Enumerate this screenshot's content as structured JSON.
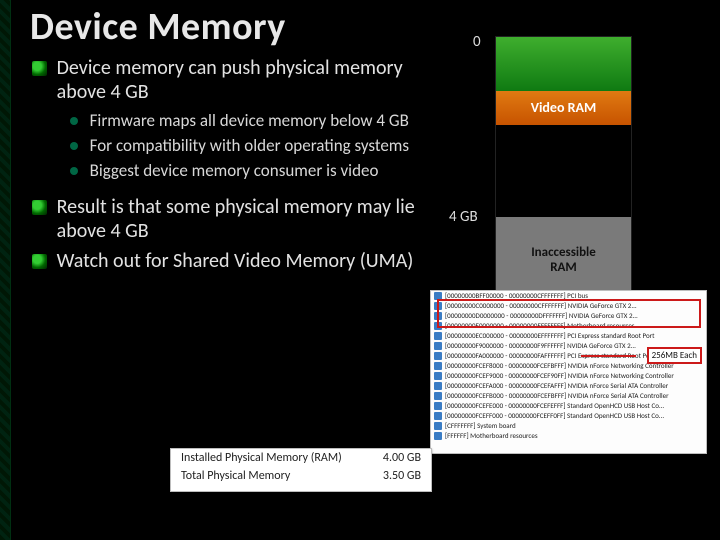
{
  "title": "Device Memory",
  "bullets": [
    {
      "text": "Device memory can push physical memory above 4 GB",
      "sub": [
        "Firmware maps all device memory below 4 GB",
        "For compatibility with older operating systems",
        "Biggest device memory consumer is video"
      ]
    },
    {
      "text": "Result is that some physical memory may lie above 4 GB"
    },
    {
      "text": "Watch out for Shared Video Memory (UMA)"
    }
  ],
  "memmap": {
    "ticks": [
      "0",
      "4 GB"
    ],
    "segments": [
      {
        "label": "",
        "color": "#1f9f1f"
      },
      {
        "label": "Video RAM",
        "color": "#d96a00"
      },
      {
        "label": "",
        "color": "#000000"
      },
      {
        "label": "Inaccessible\nRAM",
        "color": "#7a7a7a"
      }
    ]
  },
  "device_manager": {
    "callout": "256MB Each",
    "rows": [
      "[00000000BFF00000 - 00000000CFFFFFFF]  PCI bus",
      "[00000000C0000000 - 00000000CFFFFFFF]  NVIDIA GeForce GTX 2...",
      "[00000000D0000000 - 00000000DFFFFFFF]  NVIDIA GeForce GTX 2...",
      "[00000000E0000000 - 00000000EFFFFFFF]  Motherboard resources",
      "[00000000EC000000 - 00000000EFFFFFFF]  PCI Express standard Root Port",
      "[00000000F9000000 - 00000000F9FFFFFF]  NVIDIA GeForce GTX 2...",
      "[00000000FA000000 - 00000000FAFFFFFF]  PCI Express standard Root Port",
      "[00000000FCEF8000 - 00000000FCEFBFFF]  NVIDIA nForce Networking Controller",
      "[00000000FCEF9000 - 00000000FCEF90FF]  NVIDIA nForce Networking Controller",
      "[00000000FCEFA000 - 00000000FCEFAFFF]  NVIDIA nForce Serial ATA Controller",
      "[00000000FCEFB000 - 00000000FCEFBFFF]  NVIDIA nForce Serial ATA Controller",
      "[00000000FCEFE000 - 00000000FCEFEFFF]  Standard OpenHCD USB Host Co...",
      "[00000000FCEFF000 - 00000000FCEFF0FF]  Standard OpenHCD USB Host Co...",
      "[CFFFFFFF]  System board",
      "[FFFFFF]  Motherboard resources"
    ]
  },
  "phys_mem": {
    "rows": [
      {
        "label": "Installed Physical Memory (RAM)",
        "value": "4.00 GB"
      },
      {
        "label": "Total Physical Memory",
        "value": "3.50 GB"
      }
    ]
  }
}
